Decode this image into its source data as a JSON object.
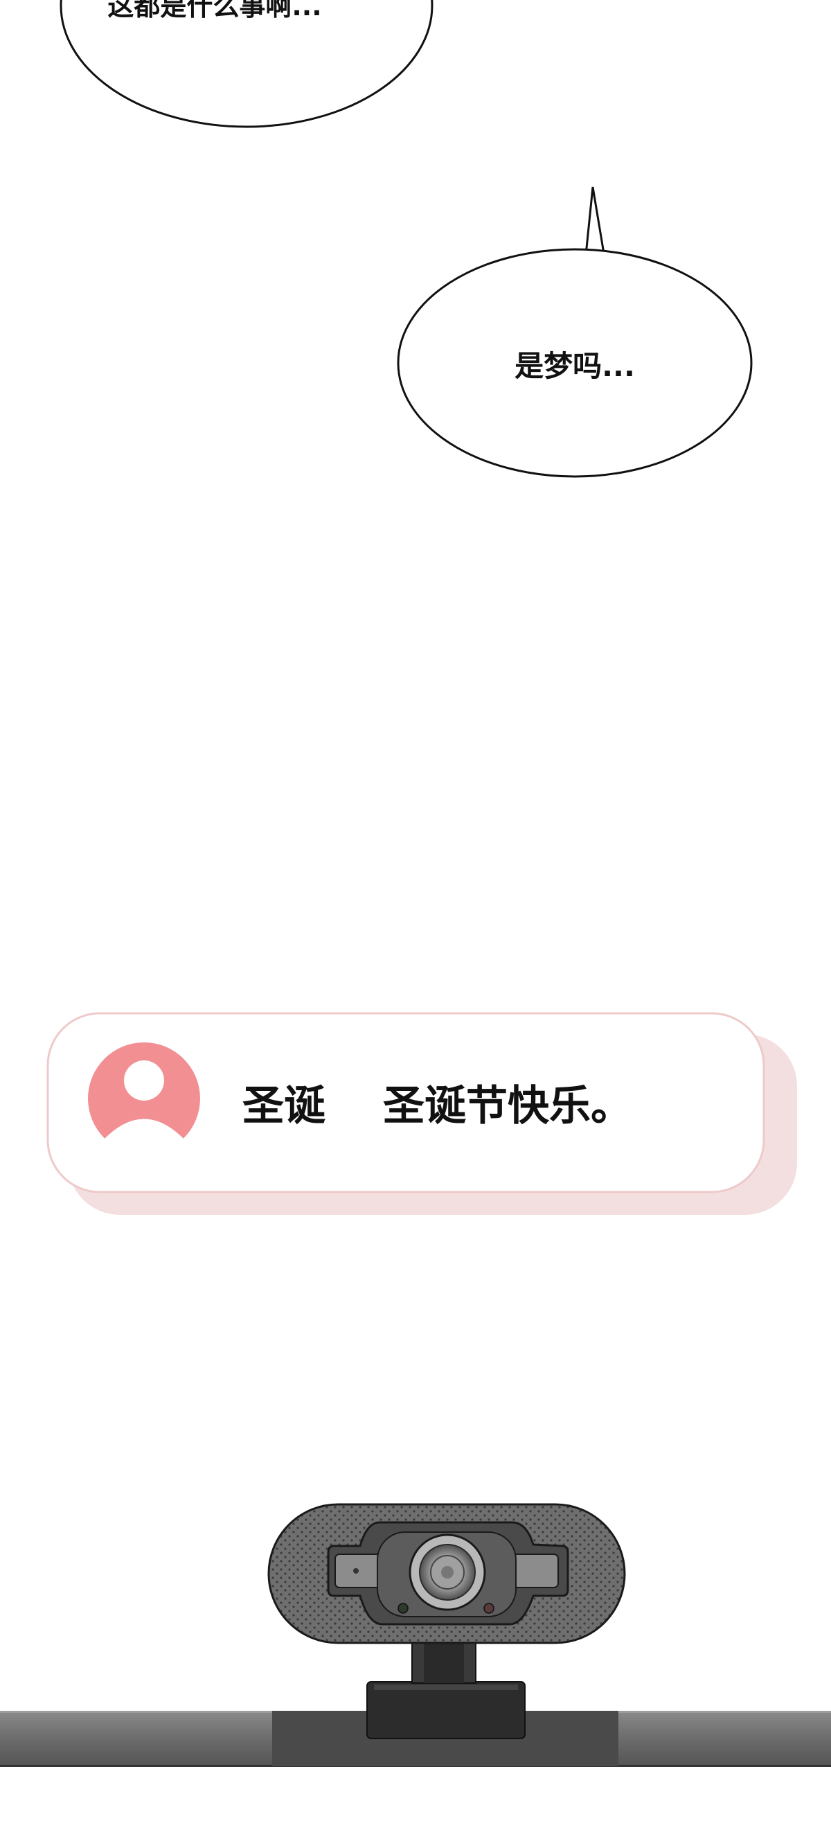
{
  "bubbles": [
    {
      "text": "这都是什么事啊..."
    },
    {
      "text": "是梦吗..."
    }
  ],
  "notification": {
    "sender": "圣诞",
    "message": "圣诞节快乐。",
    "avatar_color": "#f28f92",
    "shadow_color": "#f4dfe0",
    "border_color": "#eecaca"
  },
  "icons": [
    "user-avatar-icon",
    "webcam-icon"
  ]
}
